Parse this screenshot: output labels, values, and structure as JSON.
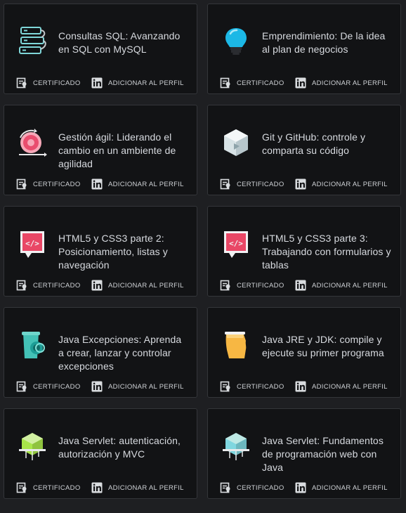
{
  "courses": [
    {
      "title": "Consultas SQL: Avanzando en SQL con MySQL",
      "icon": "database-stack-icon",
      "accent": "#7fd6d8"
    },
    {
      "title": "Emprendimiento: De la idea al plan de negocios",
      "icon": "lightbulb-icon",
      "accent": "#1cb8e6"
    },
    {
      "title": "Gestión ágil: Liderando el cambio en un ambiente de agilidad",
      "icon": "agile-cycle-icon",
      "accent": "#e94d6e"
    },
    {
      "title": "Git y GitHub: controle y comparta su código",
      "icon": "git-cube-icon",
      "accent": "#d8e3e6"
    },
    {
      "title": "HTML5 y CSS3 parte 2: Posicionamiento, listas y navegación",
      "icon": "html-code-icon",
      "accent": "#e94766"
    },
    {
      "title": "HTML5 y CSS3 parte 3: Trabajando con formularios y tablas",
      "icon": "html-code-icon",
      "accent": "#e94766"
    },
    {
      "title": "Java Excepciones: Aprenda a crear, lanzar y controlar excepciones",
      "icon": "java-cup-icon",
      "accent": "#1d9e97"
    },
    {
      "title": "Java JRE y JDK: compile y ejecute su primer programa",
      "icon": "java-bag-icon",
      "accent": "#f7b743"
    },
    {
      "title": "Java Servlet: autenticación, autorización y MVC",
      "icon": "servlet-cube-icon",
      "accent": "#a8e64a"
    },
    {
      "title": "Java Servlet: Fundamentos de programación web con Java",
      "icon": "servlet-cube-icon",
      "accent": "#7fd7e0"
    }
  ],
  "actions": {
    "certificate_label": "CERTIFICADO",
    "linkedin_label": "ADICIONAR AL PERFIL"
  }
}
